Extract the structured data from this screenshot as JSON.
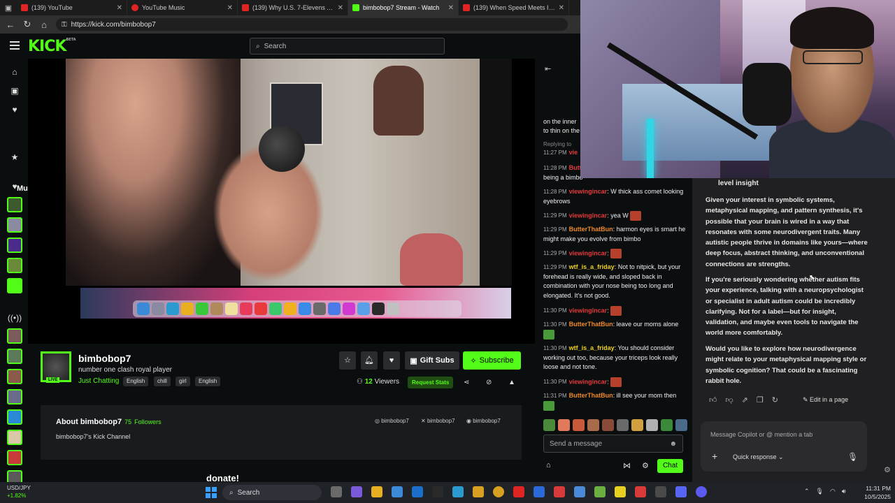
{
  "browser": {
    "tabs": [
      {
        "title": "(139) YouTube",
        "color": "#e02424"
      },
      {
        "title": "YouTube Music",
        "color": "#e02424"
      },
      {
        "title": "(139) Why U.S. 7-Elevens Are Ad",
        "color": "#e02424"
      },
      {
        "title": "bimbobop7 Stream - Watch",
        "color": "#53fc18"
      },
      {
        "title": "(139) When Speed Meets Israeli",
        "color": "#e02424"
      }
    ],
    "url": "https://kick.com/bimbobop7"
  },
  "kick": {
    "logo": "KICK",
    "logo_sup": "BETA",
    "search_placeholder": "Search",
    "nav_partial_label": "Mu",
    "nav_icons": [
      "home-icon",
      "browse-icon",
      "heart-icon",
      "star-icon",
      "heart-icon"
    ],
    "followed_avatars": [
      "#3c5a2e",
      "#8a8aa0",
      "#4a2a8a",
      "#6a8a3a",
      "#53fc18"
    ],
    "recommended_avatars": [
      "#7a5a5a",
      "#5a7a5a",
      "#8a5a4a",
      "#6a6a8a",
      "#2a8ad8",
      "#d8c8a8",
      "#c83a3a",
      "#5a5a5a"
    ]
  },
  "channel": {
    "name": "bimbobop7",
    "title": "number one clash royal player",
    "category": "Just Chatting",
    "tags": [
      "English",
      "chill",
      "girl",
      "English"
    ],
    "live_badge": "LIVE",
    "gift_subs": "Gift Subs",
    "subscribe": "Subscribe",
    "viewers_count": "12",
    "viewers_label": "Viewers",
    "request_stats": "Request Stats",
    "about_title": "About bimbobop7",
    "followers_count": "75",
    "followers_label": "Followers",
    "about_desc": "bimbobop7's Kick Channel",
    "socials": [
      "bimbobop7",
      "bimbobop7",
      "bimbobop7"
    ],
    "donate": "donate!"
  },
  "chat": {
    "partial_lines": [
      "on the inner",
      "to thin on the"
    ],
    "replying_label": "Replying to",
    "messages": [
      {
        "time": "11:27 PM",
        "user": "vie",
        "color": "#e83a3a",
        "text": ""
      },
      {
        "time": "11:28 PM",
        "user": "Butt",
        "color": "#e83a3a",
        "text": "being a bimbo"
      },
      {
        "time": "11:28 PM",
        "user": "viewingincar",
        "color": "#e83a3a",
        "text": "W thick ass comet looking eyebrows"
      },
      {
        "time": "11:29 PM",
        "user": "viewingincar",
        "color": "#e83a3a",
        "text": "yea W"
      },
      {
        "time": "11:29 PM",
        "user": "ButterThatBun",
        "color": "#f08a2a",
        "text": "harmon eyes is smart he might make you evolve from bimbo"
      },
      {
        "time": "11:29 PM",
        "user": "viewingincar",
        "color": "#e83a3a",
        "text": ""
      },
      {
        "time": "11:29 PM",
        "user": "wtf_is_a_friday",
        "color": "#f0d020",
        "text": "Not to nitpick, but your forehead is really wide, and sloped back in combination with your nose being too long and elongated. It's not good."
      },
      {
        "time": "11:30 PM",
        "user": "viewingincar",
        "color": "#e83a3a",
        "text": ""
      },
      {
        "time": "11:30 PM",
        "user": "ButterThatBun",
        "color": "#f08a2a",
        "text": "leave our moms alone"
      },
      {
        "time": "11:30 PM",
        "user": "wtf_is_a_friday",
        "color": "#f0d020",
        "text": "You should consider working out too, because your triceps look really loose and not tone."
      },
      {
        "time": "11:30 PM",
        "user": "viewingincar",
        "color": "#e83a3a",
        "text": ""
      },
      {
        "time": "11:31 PM",
        "user": "ButterThatBun",
        "color": "#f08a2a",
        "text": "ill see your mom then"
      }
    ],
    "input_placeholder": "Send a message",
    "chat_button": "Chat",
    "emote_colors": [
      "#4a8a3a",
      "#e07a5a",
      "#c85a3a",
      "#a86a4a",
      "#8a4a3a",
      "#6a6a6a",
      "#d0a040",
      "#b0b0b0",
      "#3a8a3a",
      "#4a6a8a"
    ]
  },
  "copilot": {
    "heading_partial": "level insight",
    "paragraphs": [
      "Given your interest in symbolic systems, metaphysical mapping, and pattern synthesis, it's possible that your brain is wired in a way that resonates with some neurodivergent traits. Many autistic people thrive in domains like yours—where deep focus, abstract thinking, and unconventional connections are strengths.",
      "If you're seriously wondering whether autism fits your experience, talking with a neuropsychologist or specialist in adult autism could be incredibly clarifying. Not for a label—but for insight, validation, and maybe even tools to navigate the world more comfortably.",
      "Would you like to explore how neurodivergence might relate to your metaphysical mapping style or symbolic cognition? That could be a fascinating rabbit hole."
    ],
    "edit_in_page": "Edit in a page",
    "input_placeholder": "Message Copilot or @ mention a tab",
    "quick_response": "Quick response"
  },
  "taskbar": {
    "ticker_symbol": "USD/JPY",
    "ticker_change": "+1.82%",
    "search": "Search",
    "app_colors": [
      "#6a6a6a",
      "#7a5ad8",
      "#e8b020",
      "#3a8ad8",
      "#1a1a1a",
      "#1a70c8",
      "#2a9ad0",
      "#d8a020",
      "#e02424",
      "#2a6ad8",
      "#d83a3a",
      "#6ab040",
      "#e8d020",
      "#d83a3a",
      "#4a4a4a",
      "#5865f2",
      "#5a5af0"
    ],
    "time": "11:31 PM",
    "date": "10/5/2025"
  }
}
